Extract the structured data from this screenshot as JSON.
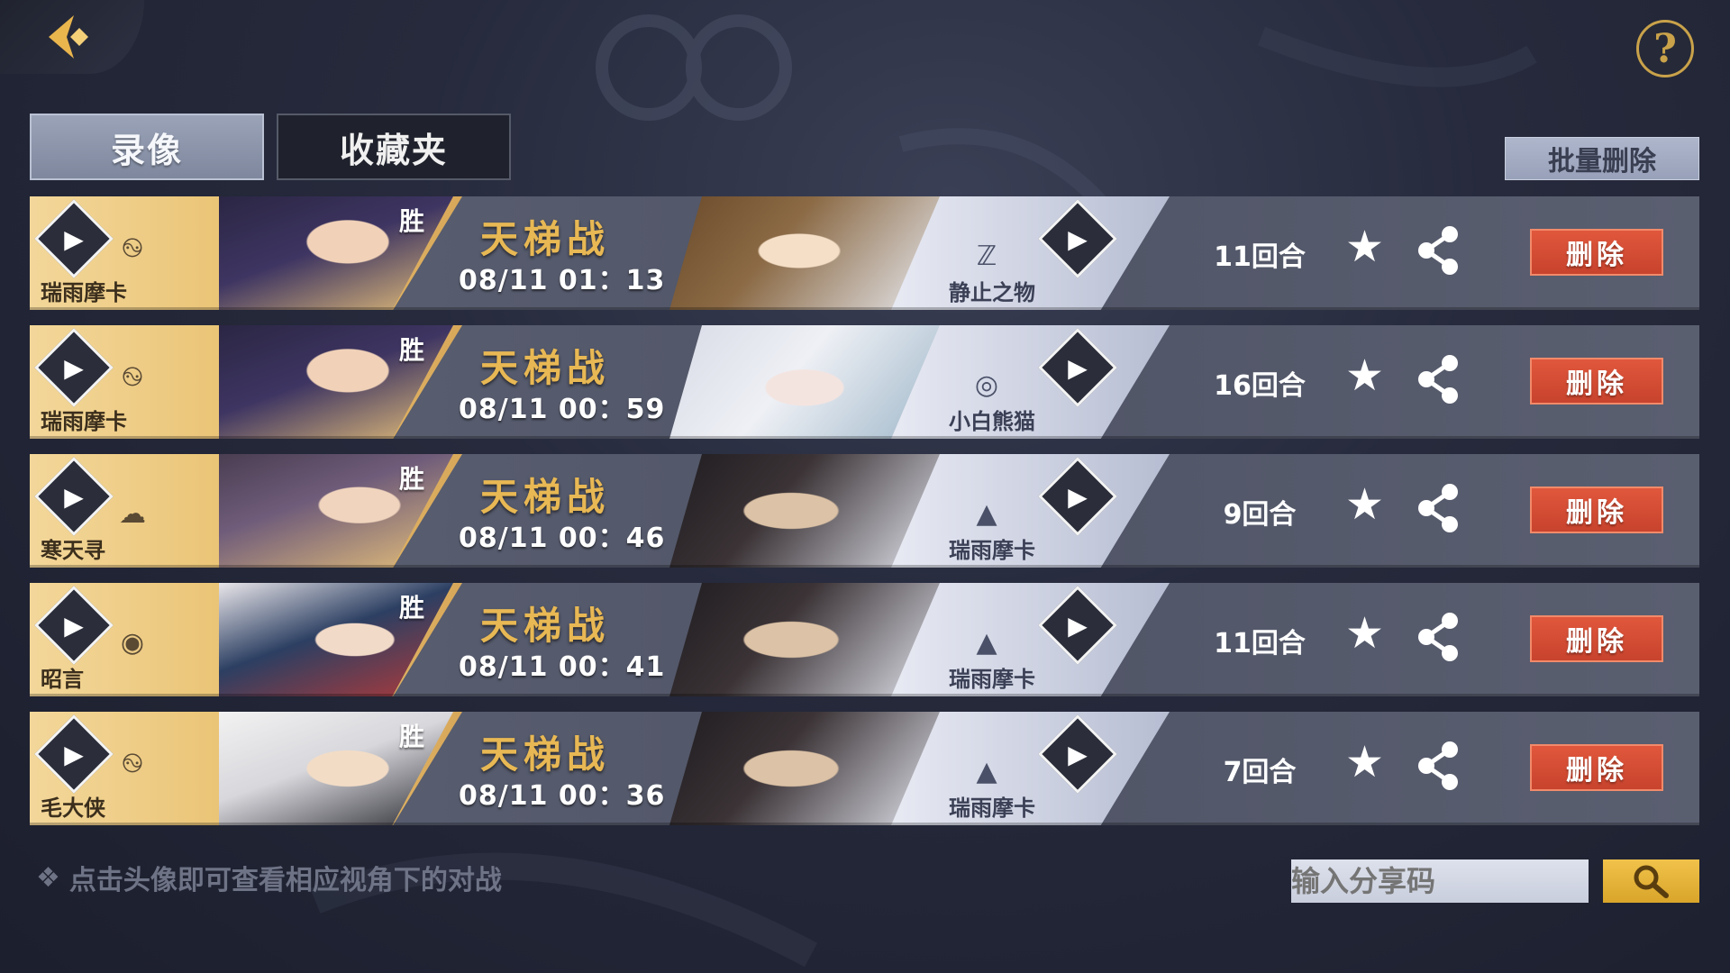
{
  "header": {
    "back_icon": "back-arrow-icon",
    "help_label": "?"
  },
  "tabs": [
    {
      "label": "录像",
      "active": true
    },
    {
      "label": "收藏夹",
      "active": false
    }
  ],
  "batch_delete_label": "批量删除",
  "records": [
    {
      "player": "瑞雨摩卡",
      "result": "胜",
      "mode": "天梯战",
      "time": "08/11 01：13",
      "opponent": "静止之物",
      "rounds": "11回合",
      "delete_label": "删除"
    },
    {
      "player": "瑞雨摩卡",
      "result": "胜",
      "mode": "天梯战",
      "time": "08/11 00：59",
      "opponent": "小白熊猫",
      "rounds": "16回合",
      "delete_label": "删除"
    },
    {
      "player": "寒天寻",
      "result": "胜",
      "mode": "天梯战",
      "time": "08/11 00：46",
      "opponent": "瑞雨摩卡",
      "rounds": "9回合",
      "delete_label": "删除"
    },
    {
      "player": "昭言",
      "result": "胜",
      "mode": "天梯战",
      "time": "08/11 00：41",
      "opponent": "瑞雨摩卡",
      "rounds": "11回合",
      "delete_label": "删除"
    },
    {
      "player": "毛大侠",
      "result": "胜",
      "mode": "天梯战",
      "time": "08/11 00：36",
      "opponent": "瑞雨摩卡",
      "rounds": "7回合",
      "delete_label": "删除"
    }
  ],
  "footer": {
    "hint": "点击头像即可查看相应视角下的对战",
    "share_code_placeholder": "输入分享码",
    "search_icon": "magnifier-icon"
  },
  "colors": {
    "accent_gold": "#e8b854",
    "delete_red": "#c8432d",
    "search_yellow": "#f1c24a"
  }
}
